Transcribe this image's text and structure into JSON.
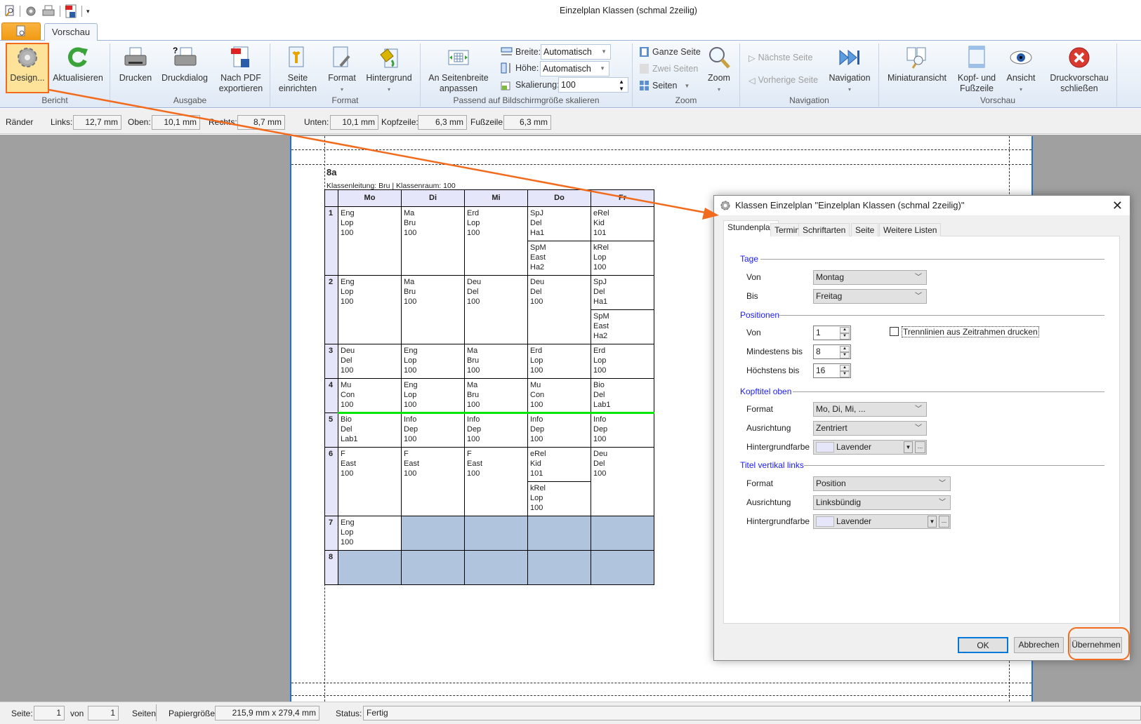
{
  "window": {
    "title": "Einzelplan Klassen (schmal 2zeilig)"
  },
  "tabs": {
    "active": "Vorschau"
  },
  "ribbon": {
    "groups": [
      "Bericht",
      "Ausgabe",
      "Format",
      "Passend auf Bildschirmgröße skalieren",
      "Zoom",
      "Navigation",
      "Vorschau"
    ],
    "design": "Design...",
    "refresh": "Aktualisieren",
    "print": "Drucken",
    "print_dialog": "Druckdialog",
    "pdf1": "Nach PDF",
    "pdf2": "exportieren",
    "page_setup1": "Seite",
    "page_setup2": "einrichten",
    "format": "Format",
    "background": "Hintergrund",
    "fit1": "An Seitenbreite",
    "fit2": "anpassen",
    "width_label": "Breite:",
    "width_value": "Automatisch",
    "height_label": "Höhe:",
    "height_value": "Automatisch",
    "scale_label": "Skalierung:",
    "scale_value": "100",
    "whole_page": "Ganze Seite",
    "two_pages": "Zwei Seiten",
    "pages": "Seiten",
    "zoom": "Zoom",
    "next_page": "Nächste Seite",
    "prev_page": "Vorherige Seite",
    "navigation": "Navigation",
    "thumbnails": "Miniaturansicht",
    "header_footer1": "Kopf- und",
    "header_footer2": "Fußzeile",
    "view": "Ansicht",
    "close1": "Druckvorschau",
    "close2": "schließen"
  },
  "margins": {
    "label": "Ränder",
    "links_label": "Links:",
    "links": "12,7 mm",
    "oben_label": "Oben:",
    "oben": "10,1 mm",
    "rechts_label": "Rechts:",
    "rechts": "8,7 mm",
    "unten_label": "Unten:",
    "unten": "10,1 mm",
    "kopf_label": "Kopfzeile:",
    "kopf": "6,3 mm",
    "fuss_label": "Fußzeile:",
    "fuss": "6,3 mm"
  },
  "report": {
    "class": "8a",
    "subtitle": "Klassenleitung: Bru | Klassenraum: 100",
    "days": [
      "Mo",
      "Di",
      "Mi",
      "Do",
      "Fr"
    ],
    "colors": {
      "header_bg": "#e6e6fa",
      "empty": "#b0c4de",
      "separator": "#00e600"
    },
    "rows": [
      {
        "pos": "1",
        "cells": [
          [
            [
              "Eng",
              "Lop",
              "100"
            ]
          ],
          [
            [
              "Ma",
              "Bru",
              "100"
            ]
          ],
          [
            [
              "Erd",
              "Lop",
              "100"
            ]
          ],
          [
            [
              "SpJ",
              "Del",
              "Ha1"
            ],
            [
              "SpM",
              "East",
              "Ha2"
            ]
          ],
          [
            [
              "eRel",
              "Kid",
              "101"
            ],
            [
              "kRel",
              "Lop",
              "100"
            ]
          ]
        ]
      },
      {
        "pos": "2",
        "cells": [
          [
            [
              "Eng",
              "Lop",
              "100"
            ]
          ],
          [
            [
              "Ma",
              "Bru",
              "100"
            ]
          ],
          [
            [
              "Deu",
              "Del",
              "100"
            ]
          ],
          [
            [
              "Deu",
              "Del",
              "100"
            ]
          ],
          [
            [
              "SpJ",
              "Del",
              "Ha1"
            ],
            [
              "SpM",
              "East",
              "Ha2"
            ]
          ]
        ]
      },
      {
        "pos": "3",
        "cells": [
          [
            [
              "Deu",
              "Del",
              "100"
            ]
          ],
          [
            [
              "Eng",
              "Lop",
              "100"
            ]
          ],
          [
            [
              "Ma",
              "Bru",
              "100"
            ]
          ],
          [
            [
              "Erd",
              "Lop",
              "100"
            ]
          ],
          [
            [
              "Erd",
              "Lop",
              "100"
            ]
          ]
        ]
      },
      {
        "pos": "4",
        "cells": [
          [
            [
              "Mu",
              "Con",
              "100"
            ]
          ],
          [
            [
              "Eng",
              "Lop",
              "100"
            ]
          ],
          [
            [
              "Ma",
              "Bru",
              "100"
            ]
          ],
          [
            [
              "Mu",
              "Con",
              "100"
            ]
          ],
          [
            [
              "Bio",
              "Del",
              "Lab1"
            ]
          ]
        ]
      },
      {
        "pos": "5",
        "cells": [
          [
            [
              "Bio",
              "Del",
              "Lab1"
            ]
          ],
          [
            [
              "Info",
              "Dep",
              "100"
            ]
          ],
          [
            [
              "Info",
              "Dep",
              "100"
            ]
          ],
          [
            [
              "Info",
              "Dep",
              "100"
            ]
          ],
          [
            [
              "Info",
              "Dep",
              "100"
            ]
          ]
        ]
      },
      {
        "pos": "6",
        "cells": [
          [
            [
              "F",
              "East",
              "100"
            ]
          ],
          [
            [
              "F",
              "East",
              "100"
            ]
          ],
          [
            [
              "F",
              "East",
              "100"
            ]
          ],
          [
            [
              "eRel",
              "Kid",
              "101"
            ],
            [
              "kRel",
              "Lop",
              "100"
            ]
          ],
          [
            [
              "Deu",
              "Del",
              "100"
            ]
          ]
        ]
      },
      {
        "pos": "7",
        "cells": [
          [
            [
              "Eng",
              "Lop",
              "100"
            ]
          ],
          null,
          null,
          null,
          null
        ]
      },
      {
        "pos": "8",
        "cells": [
          null,
          null,
          null,
          null,
          null
        ]
      }
    ]
  },
  "dialog": {
    "title": "Klassen Einzelplan \"Einzelplan Klassen (schmal 2zeilig)\"",
    "tabs": [
      "Stundenplan",
      "Termine",
      "Schriftarten",
      "Seite",
      "Weitere Listen"
    ],
    "tage": {
      "heading": "Tage",
      "von_label": "Von",
      "von": "Montag",
      "bis_label": "Bis",
      "bis": "Freitag"
    },
    "positionen": {
      "heading": "Positionen",
      "von_label": "Von",
      "von": "1",
      "min_label": "Mindestens bis",
      "min": "8",
      "max_label": "Höchstens bis",
      "max": "16",
      "checkbox_label": "Trennlinien aus Zeitrahmen drucken",
      "checkbox_checked": false
    },
    "kopftitel": {
      "heading": "Kopftitel oben",
      "format_label": "Format",
      "format": "Mo, Di, Mi, ...",
      "align_label": "Ausrichtung",
      "align": "Zentriert",
      "bg_label": "Hintergrundfarbe",
      "bg": "Lavender"
    },
    "titel_links": {
      "heading": "Titel vertikal links",
      "format_label": "Format",
      "format": "Position",
      "align_label": "Ausrichtung",
      "align": "Linksbündig",
      "bg_label": "Hintergrundfarbe",
      "bg": "Lavender"
    },
    "ok": "OK",
    "cancel": "Abbrechen",
    "apply": "Übernehmen",
    "more": "..."
  },
  "statusbar": {
    "page_label": "Seite:",
    "page": "1",
    "of_label": "von",
    "of": "1",
    "pages_label": "Seiten",
    "paper_label": "Papiergröße:",
    "paper": "215,9 mm x 279,4 mm",
    "status_label": "Status:",
    "status": "Fertig"
  },
  "accent": "#f26b1d"
}
